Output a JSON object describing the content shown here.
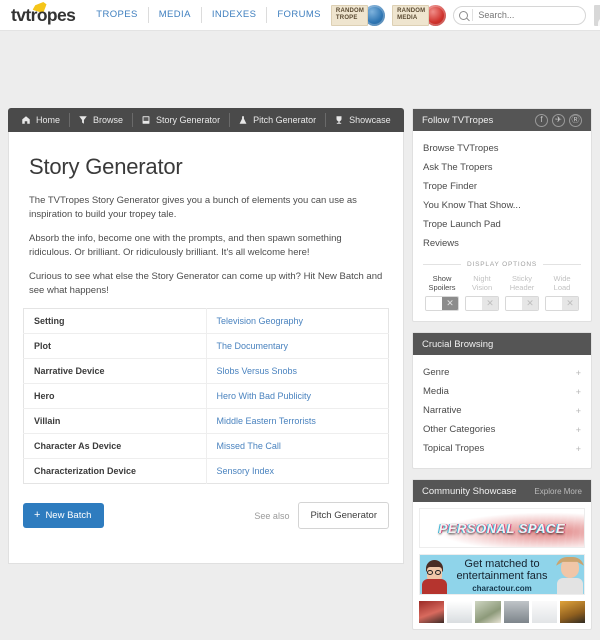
{
  "header": {
    "logo_tv": "tv",
    "logo_tropes": "tropes",
    "nav": [
      {
        "label": "TROPES"
      },
      {
        "label": "MEDIA"
      },
      {
        "label": "INDEXES"
      },
      {
        "label": "FORUMS"
      }
    ],
    "random_trope": {
      "line1": "RANDOM",
      "line2": "TROPE",
      "color": "#2f76b3"
    },
    "random_media": {
      "line1": "RANDOM",
      "line2": "MEDIA",
      "color": "#cf322c"
    },
    "search": {
      "placeholder": "Search...",
      "value": ""
    }
  },
  "tabs": [
    {
      "label": "Home",
      "icon": "home-icon"
    },
    {
      "label": "Browse",
      "icon": "funnel-icon"
    },
    {
      "label": "Story Generator",
      "icon": "book-icon"
    },
    {
      "label": "Pitch Generator",
      "icon": "flask-icon"
    },
    {
      "label": "Showcase",
      "icon": "trophy-icon"
    }
  ],
  "main": {
    "title": "Story Generator",
    "paragraphs": [
      "The TVTropes Story Generator gives you a bunch of elements you can use as inspiration to build your tropey tale.",
      "Absorb the info, become one with the prompts, and then spawn something ridiculous. Or brilliant. Or ridiculously brilliant. It's all welcome here!",
      "Curious to see what else the Story Generator can come up with? Hit New Batch and see what happens!"
    ],
    "table": [
      {
        "label": "Setting",
        "value": "Television Geography"
      },
      {
        "label": "Plot",
        "value": "The Documentary"
      },
      {
        "label": "Narrative Device",
        "value": "Slobs Versus Snobs"
      },
      {
        "label": "Hero",
        "value": "Hero With Bad Publicity"
      },
      {
        "label": "Villain",
        "value": "Middle Eastern Terrorists"
      },
      {
        "label": "Character As Device",
        "value": "Missed The Call"
      },
      {
        "label": "Characterization Device",
        "value": "Sensory Index"
      }
    ],
    "new_batch_label": "New Batch",
    "new_batch_plus": "+",
    "see_also_label": "See also",
    "pitch_generator_label": "Pitch Generator",
    "accent_color": "#2e7cbf"
  },
  "sidebar": {
    "follow": {
      "title": "Follow TVTropes",
      "social": [
        {
          "name": "facebook-icon",
          "glyph": "f"
        },
        {
          "name": "twitter-icon",
          "glyph": "✈"
        },
        {
          "name": "reddit-icon",
          "glyph": "Ⓡ"
        }
      ],
      "links": [
        {
          "label": "Browse TVTropes"
        },
        {
          "label": "Ask The Tropers"
        },
        {
          "label": "Trope Finder"
        },
        {
          "label": "You Know That Show..."
        },
        {
          "label": "Trope Launch Pad"
        },
        {
          "label": "Reviews"
        }
      ],
      "display_options_title": "DISPLAY OPTIONS",
      "toggles": [
        {
          "line1": "Show",
          "line2": "Spoilers",
          "state": "on",
          "mark": "✕"
        },
        {
          "line1": "Night",
          "line2": "Vision",
          "state": "off",
          "mark": "✕"
        },
        {
          "line1": "Sticky",
          "line2": "Header",
          "state": "off",
          "mark": "✕"
        },
        {
          "line1": "Wide",
          "line2": "Load",
          "state": "off",
          "mark": "✕"
        }
      ]
    },
    "crucial": {
      "title": "Crucial Browsing",
      "items": [
        {
          "label": "Genre",
          "mark": "+"
        },
        {
          "label": "Media",
          "mark": "+"
        },
        {
          "label": "Narrative",
          "mark": "+"
        },
        {
          "label": "Other Categories",
          "mark": "+"
        },
        {
          "label": "Topical Tropes",
          "mark": "+"
        }
      ]
    },
    "showcase": {
      "title": "Community Showcase",
      "explore_label": "Explore More",
      "ads": [
        {
          "name": "ad-personal-space",
          "text": "PERSONAL SPACE"
        },
        {
          "name": "ad-charactour",
          "line1": "Get matched to",
          "line2": "entertainment fans",
          "line3": "charactour.com"
        }
      ]
    }
  }
}
